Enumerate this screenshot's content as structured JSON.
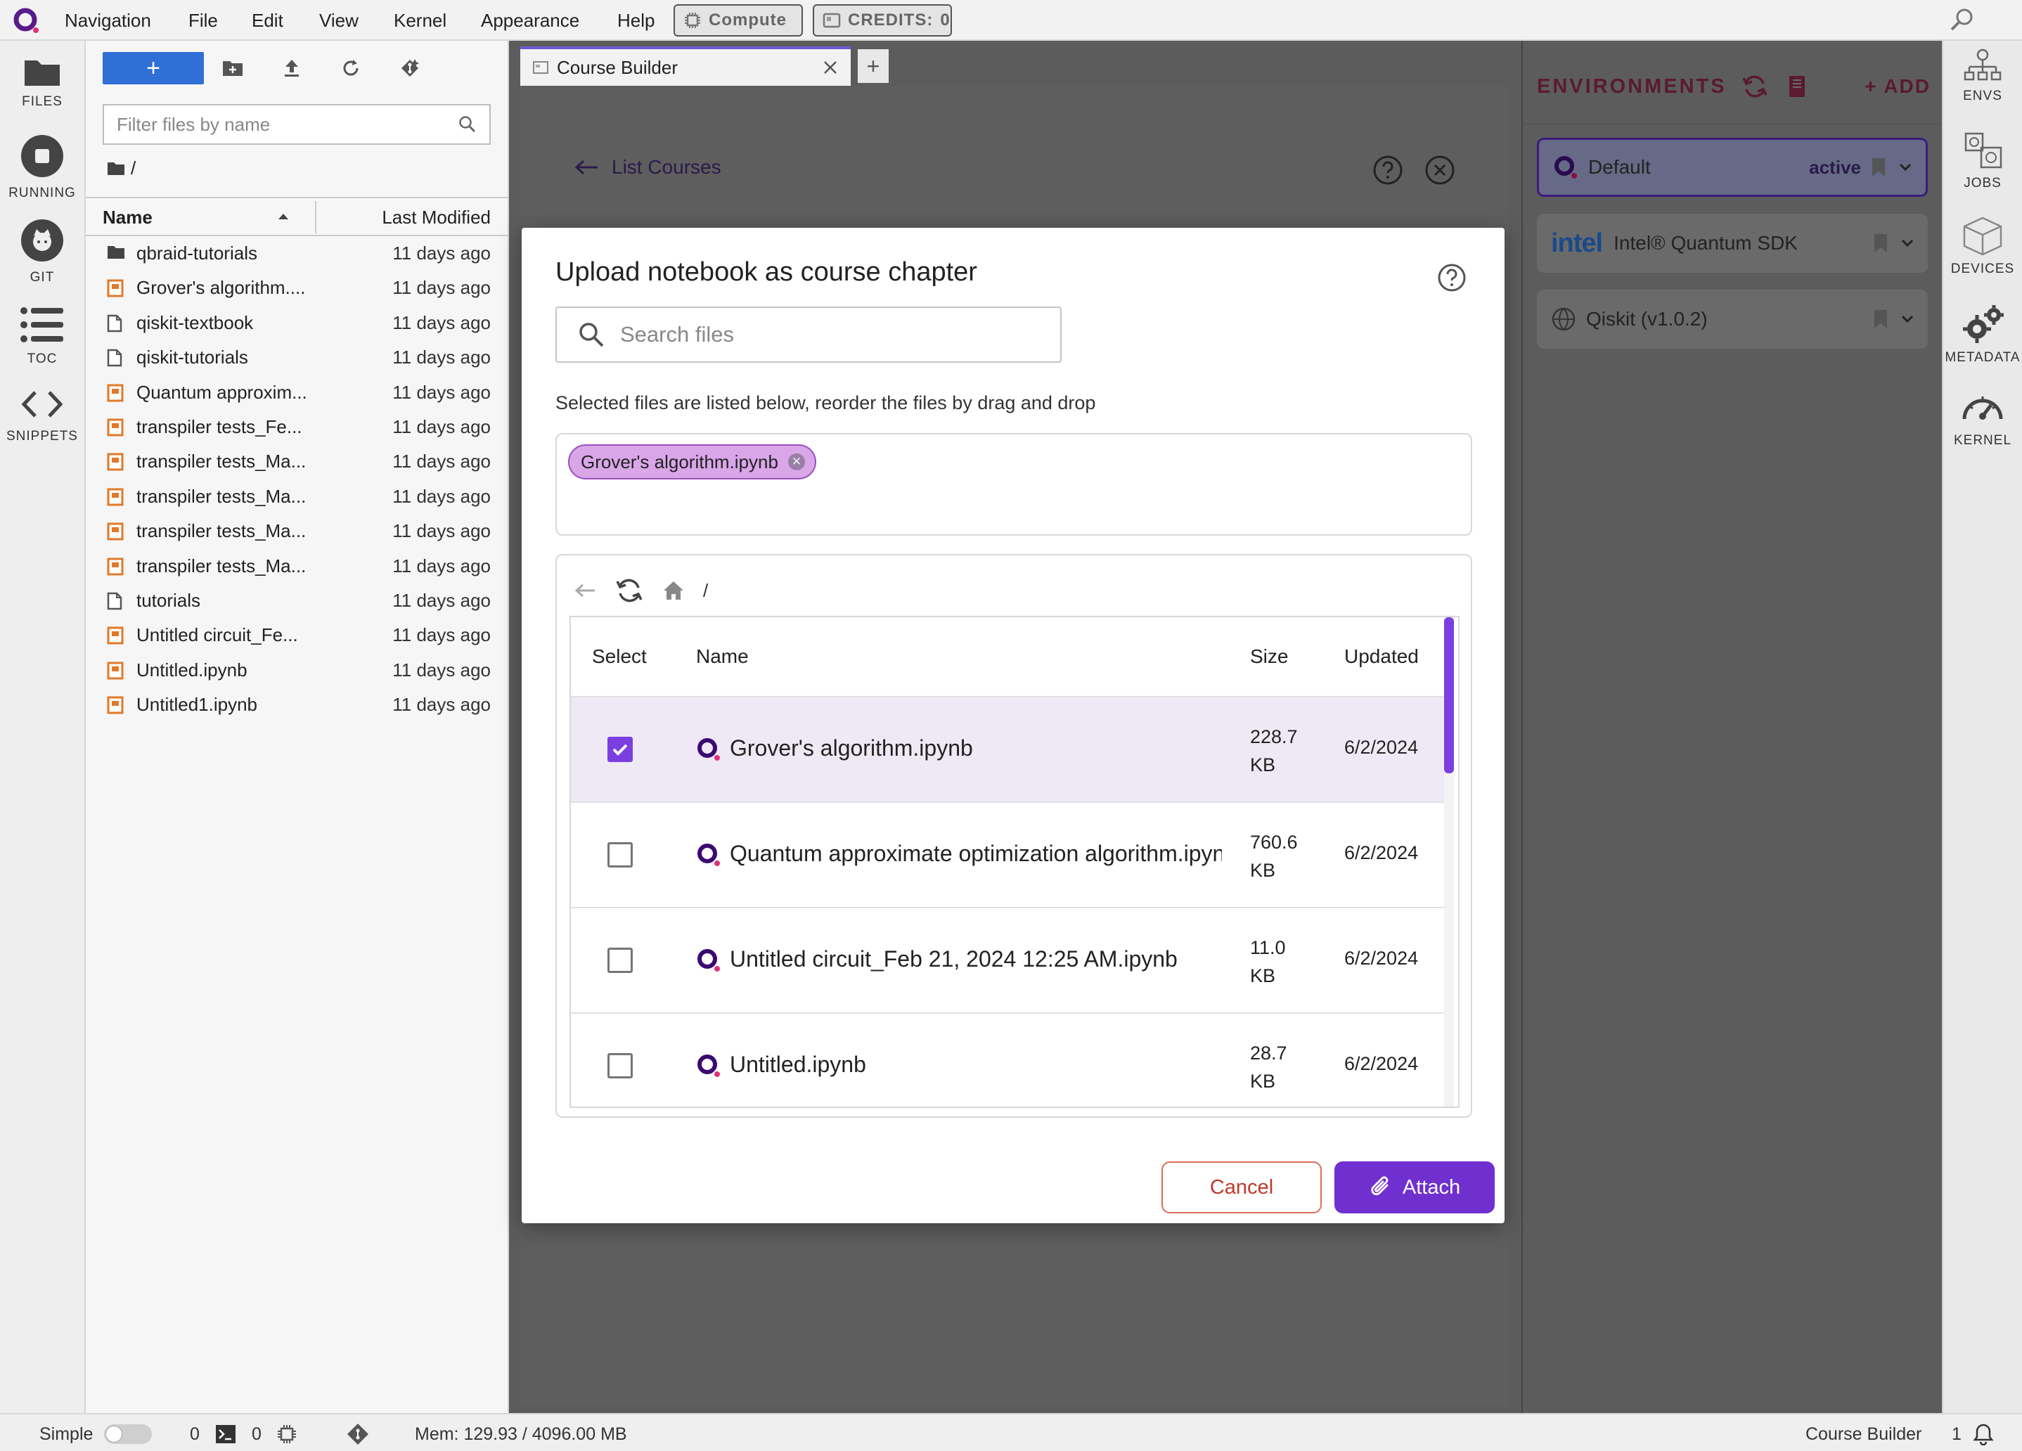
{
  "menubar": {
    "items": [
      "Navigation",
      "File",
      "Edit",
      "View",
      "Kernel",
      "Appearance",
      "Help"
    ],
    "compute_label": "Compute",
    "credits_label": "CREDITS:",
    "credits_value": "0"
  },
  "leftbar": {
    "items": [
      {
        "label": "FILES",
        "icon": "folder-icon"
      },
      {
        "label": "RUNNING",
        "icon": "stop-circle-icon"
      },
      {
        "label": "GIT",
        "icon": "git-icon"
      },
      {
        "label": "TOC",
        "icon": "list-icon"
      },
      {
        "label": "SNIPPETS",
        "icon": "code-icon"
      }
    ]
  },
  "filebrowser": {
    "new_label": "+",
    "filter_placeholder": "Filter files by name",
    "path": "/",
    "col_name": "Name",
    "col_modified": "Last Modified",
    "rows": [
      {
        "name": "qbraid-tutorials",
        "type": "folder",
        "modified": "11 days ago"
      },
      {
        "name": "Grover's algorithm....",
        "type": "notebook",
        "modified": "11 days ago"
      },
      {
        "name": "qiskit-textbook",
        "type": "file",
        "modified": "11 days ago"
      },
      {
        "name": "qiskit-tutorials",
        "type": "file",
        "modified": "11 days ago"
      },
      {
        "name": "Quantum approxim...",
        "type": "notebook",
        "modified": "11 days ago"
      },
      {
        "name": "transpiler tests_Fe...",
        "type": "notebook",
        "modified": "11 days ago"
      },
      {
        "name": "transpiler tests_Ma...",
        "type": "notebook",
        "modified": "11 days ago"
      },
      {
        "name": "transpiler tests_Ma...",
        "type": "notebook",
        "modified": "11 days ago"
      },
      {
        "name": "transpiler tests_Ma...",
        "type": "notebook",
        "modified": "11 days ago"
      },
      {
        "name": "transpiler tests_Ma...",
        "type": "notebook",
        "modified": "11 days ago"
      },
      {
        "name": "tutorials",
        "type": "file",
        "modified": "11 days ago"
      },
      {
        "name": "Untitled circuit_Fe...",
        "type": "notebook",
        "modified": "11 days ago"
      },
      {
        "name": "Untitled.ipynb",
        "type": "notebook",
        "modified": "11 days ago"
      },
      {
        "name": "Untitled1.ipynb",
        "type": "notebook",
        "modified": "11 days ago"
      }
    ]
  },
  "tabs": {
    "active_label": "Course Builder",
    "add_label": "+"
  },
  "coursebuilder": {
    "back_label": "List Courses"
  },
  "environments": {
    "title": "ENVIRONMENTS",
    "add_label": "+ ADD",
    "items": [
      {
        "name": "Default",
        "status": "active"
      },
      {
        "name": "Intel® Quantum SDK",
        "logo": "intel"
      },
      {
        "name": "Qiskit (v1.0.2)"
      }
    ]
  },
  "rightbar": {
    "items": [
      {
        "label": "ENVS",
        "icon": "envs-icon"
      },
      {
        "label": "JOBS",
        "icon": "jobs-icon"
      },
      {
        "label": "DEVICES",
        "icon": "devices-icon"
      },
      {
        "label": "METADATA",
        "icon": "gears-icon"
      },
      {
        "label": "KERNEL",
        "icon": "gauge-icon"
      }
    ]
  },
  "statusbar": {
    "mode_label": "Simple",
    "terminals_count": "0",
    "kernels_count": "0",
    "memory": "Mem: 129.93 / 4096.00 MB",
    "active_tab": "Course Builder",
    "notifications": "1"
  },
  "dialog": {
    "title": "Upload notebook as course chapter",
    "search_placeholder": "Search files",
    "instruction": "Selected files are listed below, reorder the files by drag and drop",
    "selected_chips": [
      "Grover's algorithm.ipynb"
    ],
    "browser_path": "/",
    "columns": {
      "select": "Select",
      "name": "Name",
      "size": "Size",
      "updated": "Updated"
    },
    "files": [
      {
        "name": "Grover's algorithm.ipynb",
        "size_num": "228.7",
        "size_unit": "KB",
        "updated": "6/2/2024",
        "checked": true
      },
      {
        "name": "Quantum approximate optimization algorithm.ipynb",
        "size_num": "760.6",
        "size_unit": "KB",
        "updated": "6/2/2024",
        "checked": false
      },
      {
        "name": "Untitled circuit_Feb 21, 2024 12:25 AM.ipynb",
        "size_num": "11.0",
        "size_unit": "KB",
        "updated": "6/2/2024",
        "checked": false
      },
      {
        "name": "Untitled.ipynb",
        "size_num": "28.7",
        "size_unit": "KB",
        "updated": "6/2/2024",
        "checked": false
      }
    ],
    "cancel_label": "Cancel",
    "attach_label": "Attach"
  },
  "colors": {
    "accent": "#7030d0",
    "brand_pink": "#c0306a",
    "cancel_red": "#c0392b"
  }
}
